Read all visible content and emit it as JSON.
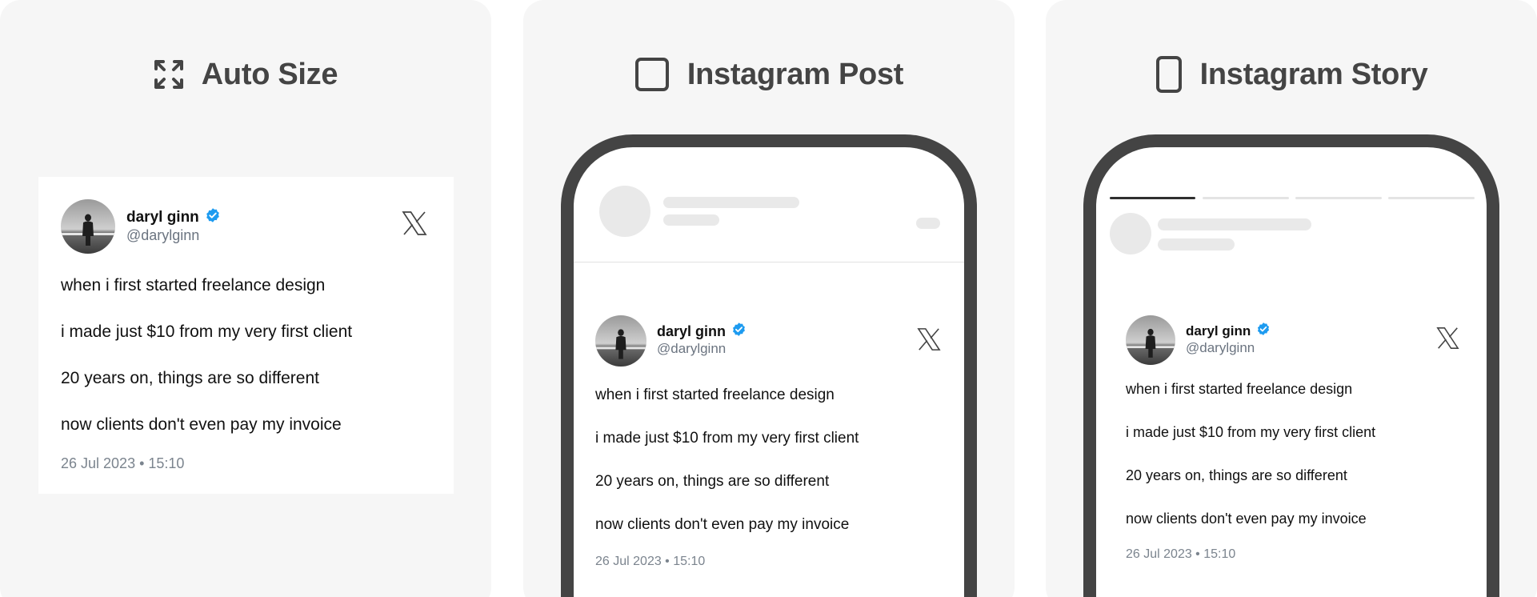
{
  "panels": [
    {
      "title": "Auto Size",
      "icon": "expand-arrows-icon"
    },
    {
      "title": "Instagram Post",
      "icon": "square-outline-icon"
    },
    {
      "title": "Instagram Story",
      "icon": "phone-outline-icon"
    }
  ],
  "tweet": {
    "name": "daryl ginn",
    "handle": "@darylginn",
    "lines": [
      "when i first started freelance design",
      "i made just $10 from my very first client",
      "20 years on, things are so different",
      "now clients don't even pay my invoice"
    ],
    "timestamp": "26 Jul 2023 • 15:10"
  },
  "colors": {
    "panel_bg": "#f6f6f6",
    "title": "#444444",
    "verified": "#1d9bf0",
    "phone_frame": "#444444",
    "skeleton": "#e9e9e9",
    "muted": "#6b7480"
  }
}
